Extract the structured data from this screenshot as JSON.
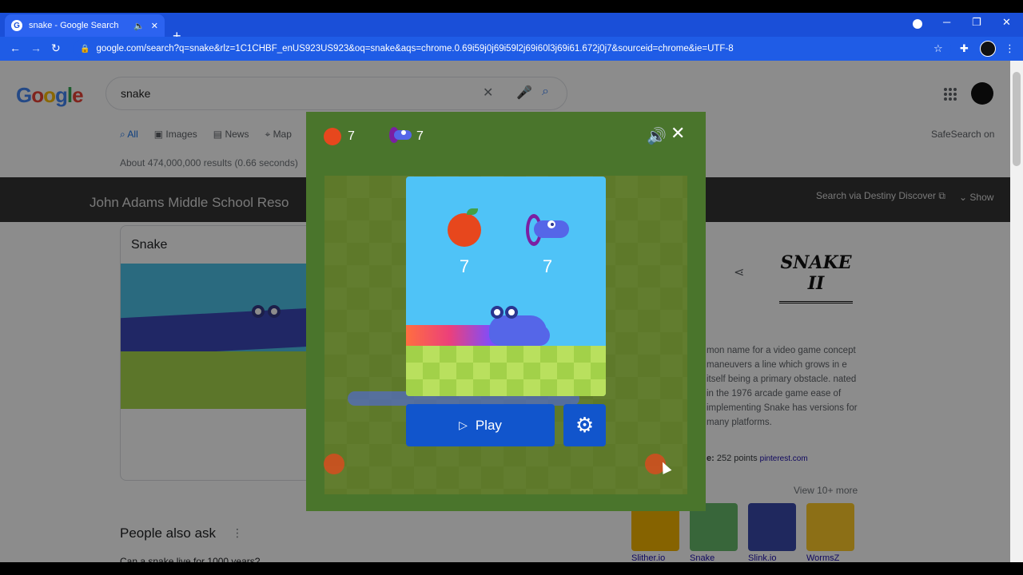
{
  "browser": {
    "tab_title": "snake - Google Search",
    "tab_audio_icon": "speaker-icon",
    "tab_close": "✕",
    "new_tab": "+",
    "url": "google.com/search?q=snake&rlz=1C1CHBF_enUS923US923&oq=snake&aqs=chrome.0.69i59j0j69i59l2j69i60l3j69i61.672j0j7&sourceid=chrome&ie=UTF-8",
    "window_controls": {
      "minimize": "─",
      "maximize": "❐",
      "close": "✕"
    }
  },
  "google": {
    "logo_letters": [
      "G",
      "o",
      "o",
      "g",
      "l",
      "e"
    ],
    "query": "snake",
    "tabs": [
      {
        "label": "All",
        "icon": "search-icon",
        "active": true
      },
      {
        "label": "Images",
        "icon": "image-icon"
      },
      {
        "label": "News",
        "icon": "news-icon"
      },
      {
        "label": "Map",
        "icon": "map-pin-icon"
      }
    ],
    "safesearch": "SafeSearch on",
    "result_stats": "About 474,000,000 results (0.66 seconds)"
  },
  "destiny": {
    "title": "John Adams Middle School Reso",
    "link": "Search via Destiny Discover",
    "show": "Show"
  },
  "card": {
    "title": "Snake"
  },
  "knowledge_panel": {
    "logo_text": "SNAKE II",
    "description": "mon name for a video game concept maneuvers a line which grows in e itself being a primary obstacle. nated in the 1976 arcade game ease of implementing Snake has versions for many platforms.",
    "points_label": "e:",
    "points_value": "252 points",
    "points_source": "pinterest.com",
    "view_more": "View 10+ more",
    "thumbnails": [
      {
        "label": "Slither.io",
        "color": "#f4b400"
      },
      {
        "label": "Snake",
        "color": "#66bb6a"
      },
      {
        "label": "Slink.io",
        "color": "#3949ab"
      },
      {
        "label": "WormsZ",
        "color": "#ffca28"
      }
    ]
  },
  "people_also_ask": {
    "title": "People also ask",
    "menu": "⋮",
    "first_question": "Can a snake live for 1000 years?"
  },
  "game": {
    "header_apple_score": "7",
    "header_best_score": "7",
    "sound_icon": "speaker-icon",
    "close_icon": "close-icon",
    "menu_apple_score": "7",
    "menu_best_score": "7",
    "play_label": "Play",
    "colors": {
      "frame": "#4a752c",
      "sky": "#4fc3f7",
      "button": "#1155cc",
      "apple": "#e7471d"
    }
  }
}
